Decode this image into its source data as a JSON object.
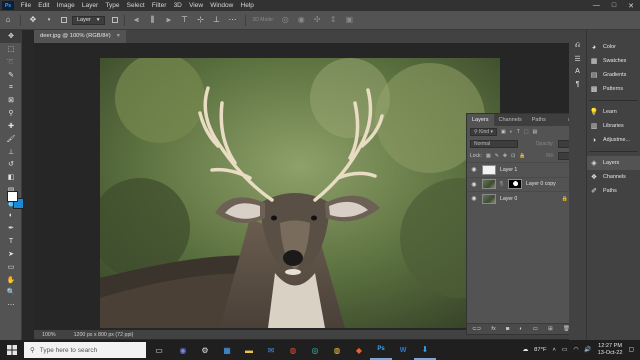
{
  "app": {
    "name": "Photoshop",
    "logo_text": "Ps"
  },
  "menubar": {
    "items": [
      "File",
      "Edit",
      "Image",
      "Layer",
      "Type",
      "Select",
      "Filter",
      "3D",
      "View",
      "Window",
      "Help"
    ],
    "window_controls": [
      "—",
      "□",
      "✕"
    ]
  },
  "options_bar": {
    "layer_select_value": "Layer",
    "mode_label": "3D Mode:"
  },
  "document": {
    "tab_title": "deer.jpg @ 100% (RGB/8#)",
    "tab_close": "×",
    "zoom": "100%",
    "doc_info": "1200 px x 800 px (72 ppi)"
  },
  "tools": [
    "move-icon",
    "marquee-icon",
    "lasso-icon",
    "quick-select-icon",
    "crop-icon",
    "frame-icon",
    "eyedropper-icon",
    "healing-icon",
    "brush-icon",
    "stamp-icon",
    "history-brush-icon",
    "eraser-icon",
    "gradient-icon",
    "blur-icon",
    "dodge-icon",
    "pen-icon",
    "type-icon",
    "path-select-icon",
    "rectangle-icon",
    "hand-icon",
    "zoom-icon"
  ],
  "colors": {
    "foreground": "#ffffff",
    "background": "#1a8ad8"
  },
  "layers_panel": {
    "tabs": [
      {
        "label": "Layers",
        "active": true
      },
      {
        "label": "Channels",
        "active": false
      },
      {
        "label": "Paths",
        "active": false
      }
    ],
    "filter_kind": "Kind",
    "blend_mode": "Normal",
    "opacity_label": "Opacity:",
    "lock_label": "Lock:",
    "fill_label": "Fill:",
    "layers": [
      {
        "name": "Layer 1",
        "thumb": "white",
        "mask": false,
        "locked": false
      },
      {
        "name": "Layer 0 copy",
        "thumb": "deer",
        "mask": true,
        "locked": false
      },
      {
        "name": "Layer 0",
        "thumb": "deer",
        "mask": false,
        "locked": true
      }
    ]
  },
  "right_dock": {
    "items": [
      {
        "label": "Color",
        "icon": "color-wheel-icon"
      },
      {
        "label": "Swatches",
        "icon": "swatches-grid-icon"
      },
      {
        "label": "Gradients",
        "icon": "gradient-icon"
      },
      {
        "label": "Patterns",
        "icon": "patterns-icon"
      },
      {
        "label": "Learn",
        "icon": "lightbulb-icon"
      },
      {
        "label": "Libraries",
        "icon": "libraries-icon"
      },
      {
        "label": "Adjustme...",
        "icon": "adjustments-icon"
      },
      {
        "label": "Layers",
        "icon": "layers-icon"
      },
      {
        "label": "Channels",
        "icon": "channels-icon"
      },
      {
        "label": "Paths",
        "icon": "paths-icon"
      }
    ]
  },
  "taskbar": {
    "search_placeholder": "Type here to search",
    "weather": "87°F",
    "time": "12:27 PM",
    "date": "13-Oct-22"
  }
}
